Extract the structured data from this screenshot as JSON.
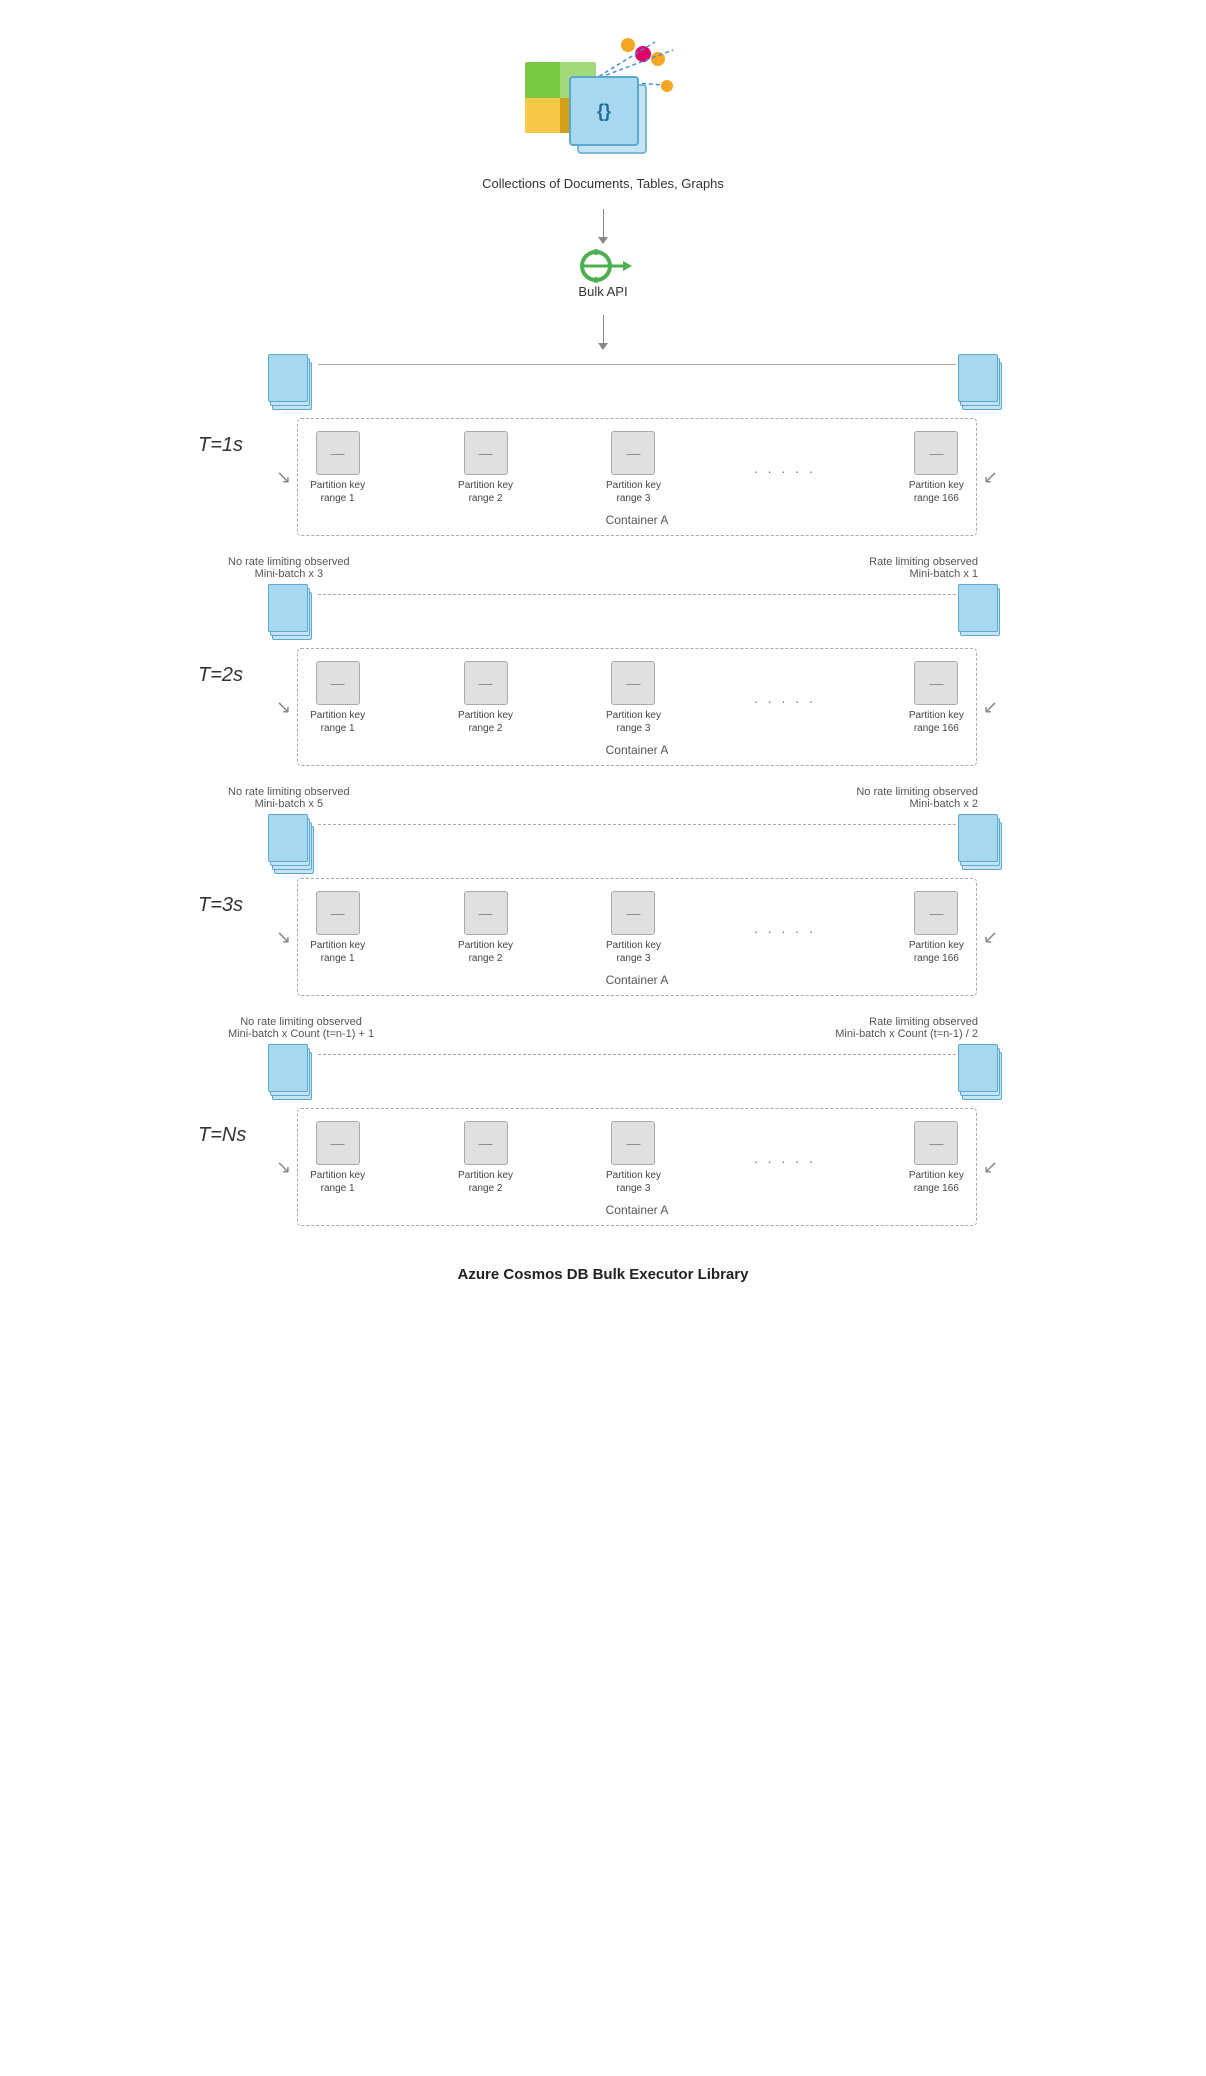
{
  "title": "Azure Cosmos DB Bulk Executor Library",
  "top": {
    "caption": "Collections of Documents, Tables, Graphs",
    "bulk_api_label": "Bulk API"
  },
  "tiers": [
    {
      "time": "T=1s",
      "left_info": null,
      "right_info": null,
      "container_label": "Container A"
    },
    {
      "time": "T=2s",
      "left_info": {
        "status": "No rate limiting observed",
        "batch": "Mini-batch x 3"
      },
      "right_info": {
        "status": "Rate limiting observed",
        "batch": "Mini-batch x 1"
      },
      "container_label": "Container A"
    },
    {
      "time": "T=3s",
      "left_info": {
        "status": "No rate limiting observed",
        "batch": "Mini-batch x 5"
      },
      "right_info": {
        "status": "No rate limiting observed",
        "batch": "Mini-batch x 2"
      },
      "container_label": "Container A"
    },
    {
      "time": "T=Ns",
      "left_info": {
        "status": "No rate limiting observed",
        "batch": "Mini-batch x Count (t=n-1) + 1"
      },
      "right_info": {
        "status": "Rate limiting observed",
        "batch": "Mini-batch x Count (t=n-1) / 2"
      },
      "container_label": "Container A"
    }
  ],
  "partitions": [
    {
      "label": "Partition key\nrange 1"
    },
    {
      "label": "Partition key\nrange 2"
    },
    {
      "label": "Partition key\nrange 3"
    },
    {
      "label": "Partition key\nrange 166"
    }
  ]
}
